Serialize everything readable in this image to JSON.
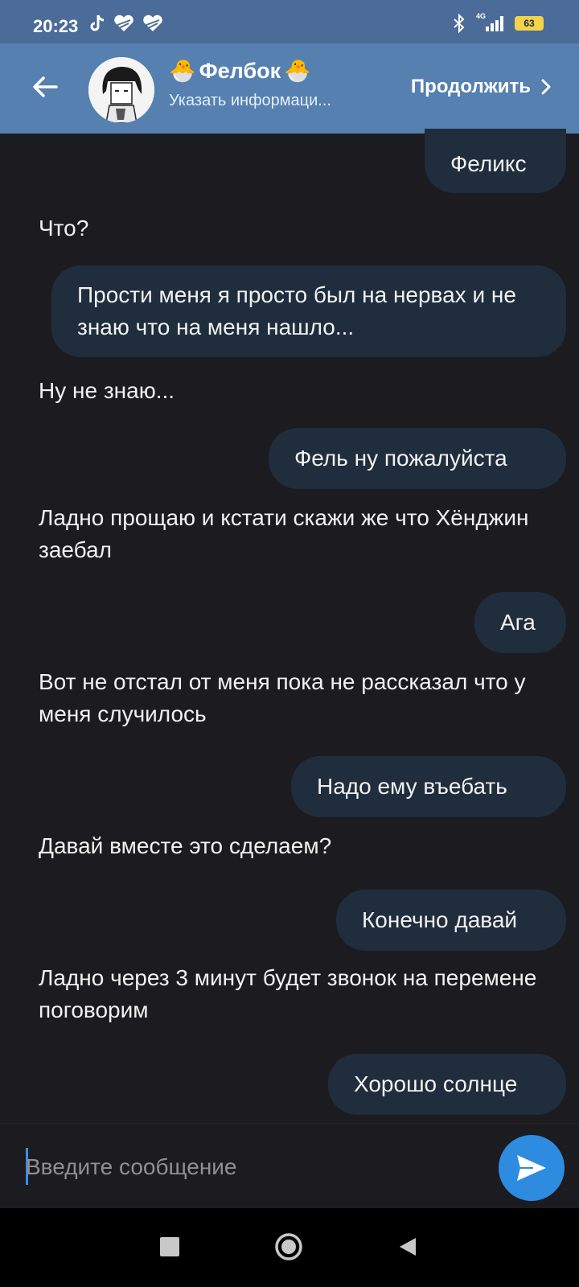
{
  "status_bar": {
    "time": "20:23",
    "network": "4G",
    "battery": "63"
  },
  "header": {
    "title": "Фелбок",
    "title_emoji": "🐣",
    "subtitle": "Указать информаци...",
    "continue_label": "Продолжить"
  },
  "messages": [
    {
      "side": "outgoing",
      "text": "Феликс"
    },
    {
      "side": "incoming",
      "text": "Что?"
    },
    {
      "side": "outgoing",
      "text": "Прости меня я просто был на нервах и не знаю что на меня нашло..."
    },
    {
      "side": "incoming",
      "text": "Ну не знаю..."
    },
    {
      "side": "outgoing",
      "text": "Фель ну пожалуйста"
    },
    {
      "side": "incoming",
      "text": "Ладно прощаю и кстати скажи же что Хёнджин заебал"
    },
    {
      "side": "outgoing",
      "text": "Ага"
    },
    {
      "side": "incoming",
      "text": "Вот не отстал от меня пока не рассказал что у меня случилось"
    },
    {
      "side": "outgoing",
      "text": "Надо ему въебать"
    },
    {
      "side": "incoming",
      "text": "Давай вместе это сделаем?"
    },
    {
      "side": "outgoing",
      "text": "Конечно давай"
    },
    {
      "side": "incoming",
      "text": "Ладно через 3 минут будет звонок на перемене поговорим"
    },
    {
      "side": "outgoing",
      "text": "Хорошо солнце"
    }
  ],
  "input": {
    "placeholder": "Введите сообщение",
    "value": ""
  },
  "colors": {
    "background": "#1c1b1f",
    "header": "#5580b0",
    "status_bar": "#4b6c98",
    "outgoing_bubble": "#1f2d3d",
    "send_button": "#2d8be0"
  }
}
